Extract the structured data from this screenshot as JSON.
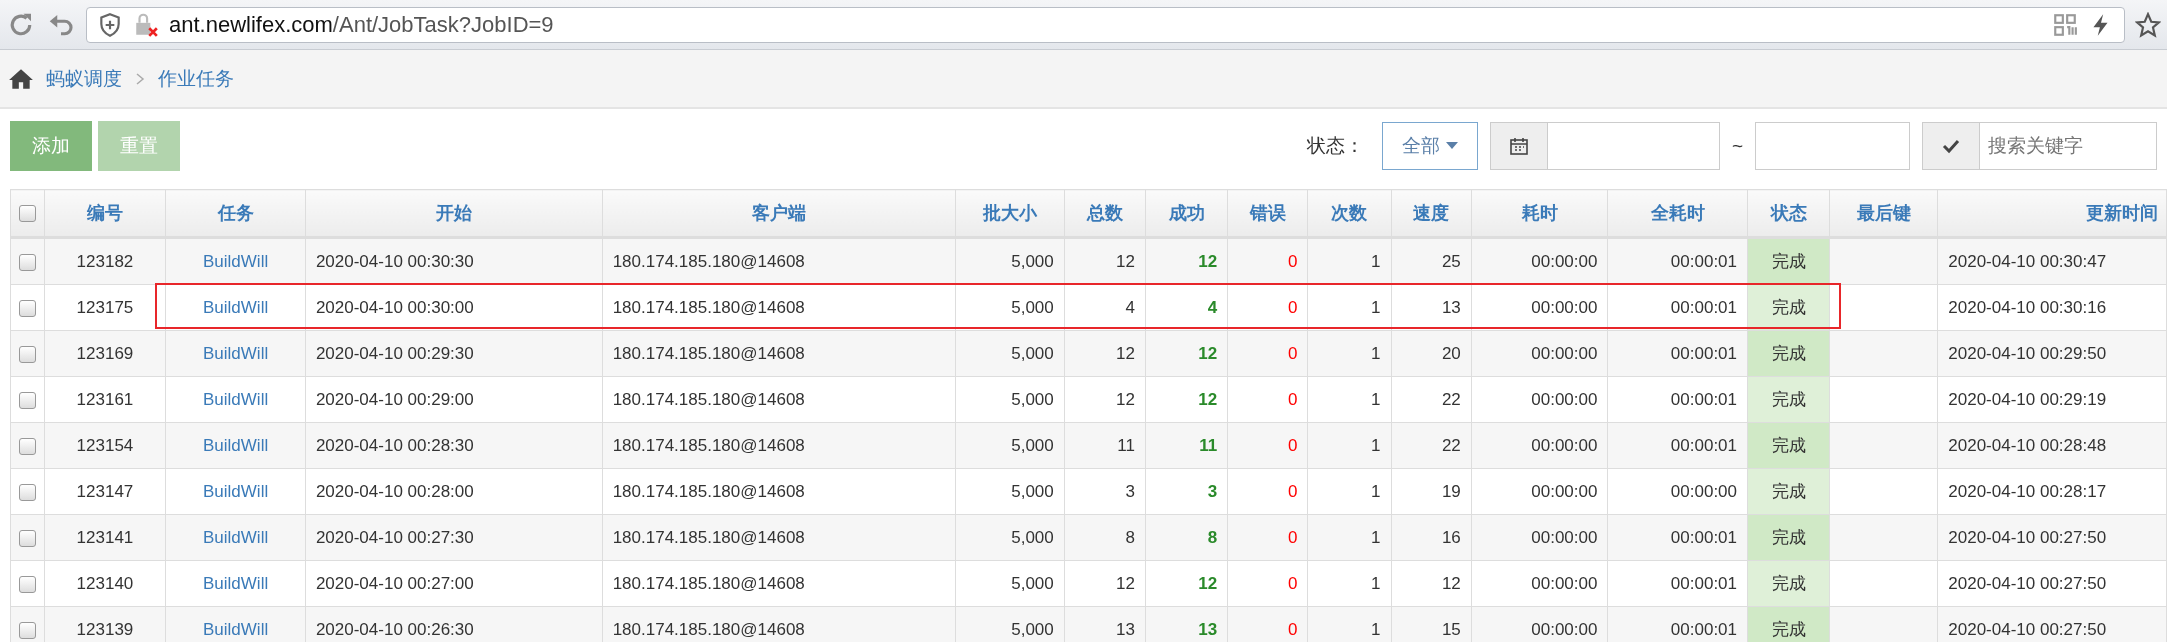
{
  "browser": {
    "url_host": "ant.newlifex.com",
    "url_path": "/Ant/JobTask?JobID=9"
  },
  "breadcrumb": [
    "蚂蚁调度",
    "作业任务"
  ],
  "toolbar": {
    "buttons": [
      {
        "label": "添加",
        "kind": "primary"
      },
      {
        "label": "重置",
        "kind": "light"
      }
    ]
  },
  "filters": {
    "status_label": "状态：",
    "status_value": "全部",
    "date_separator": "~",
    "search_placeholder": "搜索关键字"
  },
  "table": {
    "all_checked": false,
    "columns": [
      "编号",
      "任务",
      "开始",
      "客户端",
      "批大小",
      "总数",
      "成功",
      "错误",
      "次数",
      "速度",
      "耗时",
      "全耗时",
      "状态",
      "最后键",
      "更新时间"
    ],
    "rows": [
      {
        "checked": false,
        "highlighted": false,
        "id": "123182",
        "task": "BuildWill",
        "start": "2020-04-10 00:30:30",
        "client": "180.174.185.180@14608",
        "batch_size": "5,000",
        "total": "12",
        "success": "12",
        "errors": "0",
        "times": "1",
        "speed": "25",
        "elapsed": "00:00:00",
        "total_elapsed": "00:00:01",
        "status": "完成",
        "updated": "2020-04-10 00:30:47"
      },
      {
        "checked": false,
        "highlighted": true,
        "id": "123175",
        "task": "BuildWill",
        "start": "2020-04-10 00:30:00",
        "client": "180.174.185.180@14608",
        "batch_size": "5,000",
        "total": "4",
        "success": "4",
        "errors": "0",
        "times": "1",
        "speed": "13",
        "elapsed": "00:00:00",
        "total_elapsed": "00:00:01",
        "status": "完成",
        "updated": "2020-04-10 00:30:16"
      },
      {
        "checked": false,
        "highlighted": false,
        "id": "123169",
        "task": "BuildWill",
        "start": "2020-04-10 00:29:30",
        "client": "180.174.185.180@14608",
        "batch_size": "5,000",
        "total": "12",
        "success": "12",
        "errors": "0",
        "times": "1",
        "speed": "20",
        "elapsed": "00:00:00",
        "total_elapsed": "00:00:01",
        "status": "完成",
        "updated": "2020-04-10 00:29:50"
      },
      {
        "checked": false,
        "highlighted": false,
        "id": "123161",
        "task": "BuildWill",
        "start": "2020-04-10 00:29:00",
        "client": "180.174.185.180@14608",
        "batch_size": "5,000",
        "total": "12",
        "success": "12",
        "errors": "0",
        "times": "1",
        "speed": "22",
        "elapsed": "00:00:00",
        "total_elapsed": "00:00:01",
        "status": "完成",
        "updated": "2020-04-10 00:29:19"
      },
      {
        "checked": false,
        "highlighted": false,
        "id": "123154",
        "task": "BuildWill",
        "start": "2020-04-10 00:28:30",
        "client": "180.174.185.180@14608",
        "batch_size": "5,000",
        "total": "11",
        "success": "11",
        "errors": "0",
        "times": "1",
        "speed": "22",
        "elapsed": "00:00:00",
        "total_elapsed": "00:00:01",
        "status": "完成",
        "updated": "2020-04-10 00:28:48"
      },
      {
        "checked": false,
        "highlighted": false,
        "id": "123147",
        "task": "BuildWill",
        "start": "2020-04-10 00:28:00",
        "client": "180.174.185.180@14608",
        "batch_size": "5,000",
        "total": "3",
        "success": "3",
        "errors": "0",
        "times": "1",
        "speed": "19",
        "elapsed": "00:00:00",
        "total_elapsed": "00:00:00",
        "status": "完成",
        "updated": "2020-04-10 00:28:17"
      },
      {
        "checked": false,
        "highlighted": false,
        "id": "123141",
        "task": "BuildWill",
        "start": "2020-04-10 00:27:30",
        "client": "180.174.185.180@14608",
        "batch_size": "5,000",
        "total": "8",
        "success": "8",
        "errors": "0",
        "times": "1",
        "speed": "16",
        "elapsed": "00:00:00",
        "total_elapsed": "00:00:01",
        "status": "完成",
        "updated": "2020-04-10 00:27:50"
      },
      {
        "checked": false,
        "highlighted": false,
        "id": "123140",
        "task": "BuildWill",
        "start": "2020-04-10 00:27:00",
        "client": "180.174.185.180@14608",
        "batch_size": "5,000",
        "total": "12",
        "success": "12",
        "errors": "0",
        "times": "1",
        "speed": "12",
        "elapsed": "00:00:00",
        "total_elapsed": "00:00:01",
        "status": "完成",
        "updated": "2020-04-10 00:27:50"
      },
      {
        "checked": false,
        "highlighted": false,
        "id": "123139",
        "task": "BuildWill",
        "start": "2020-04-10 00:26:30",
        "client": "180.174.185.180@14608",
        "batch_size": "5,000",
        "total": "13",
        "success": "13",
        "errors": "0",
        "times": "1",
        "speed": "15",
        "elapsed": "00:00:00",
        "total_elapsed": "00:00:01",
        "status": "完成",
        "updated": "2020-04-10 00:27:50"
      }
    ]
  }
}
